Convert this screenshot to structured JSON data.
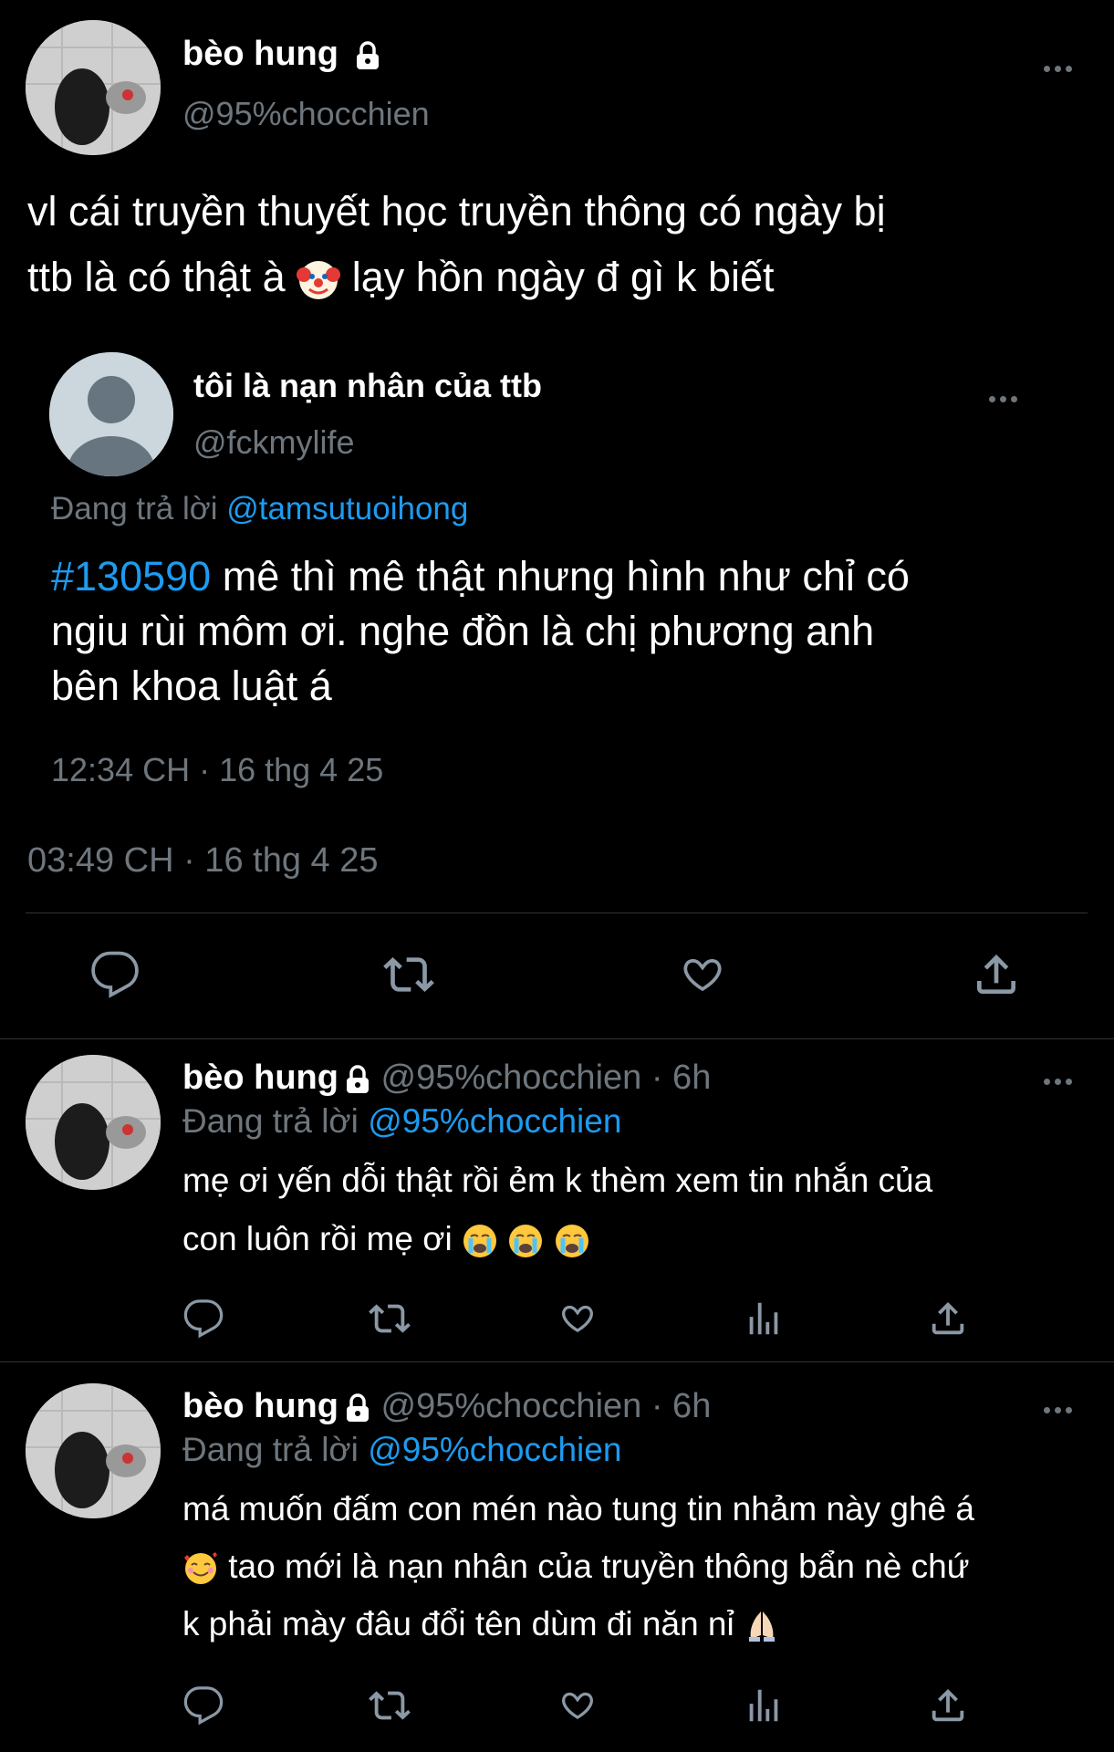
{
  "main_tweet": {
    "author_name": "bèo hung",
    "author_handle": "@95%chocchien",
    "text_line1": "vl cái truyền thuyết học truyền thông có ngày bị",
    "text_line2a": "ttb là có thật à",
    "text_line2b": "lạy hồn ngày đ gì k biết",
    "timestamp": "03:49 CH · 16 thg 4 25"
  },
  "quoted_tweet": {
    "author_name": "tôi là nạn nhân của ttb",
    "author_handle": "@fckmylife",
    "reply_prefix": "Đang trả lời",
    "reply_to": "@tamsutuoihong",
    "hashtag": "#130590",
    "text_line1": "mê thì mê thật nhưng hình như chỉ có",
    "text_line2": "ngiu rùi môm ơi. nghe đồn là chị phương anh",
    "text_line3": "bên khoa luật á",
    "timestamp": "12:34 CH · 16 thg 4 25"
  },
  "replies": [
    {
      "author_name": "bèo hung",
      "author_handle": "@95%chocchien",
      "time": "· 6h",
      "reply_prefix": "Đang trả lời",
      "reply_to": "@95%chocchien",
      "text_line1": "mẹ ơi yến dỗi thật rồi ẻm k thèm xem tin nhắn của",
      "text_line2": "con luôn rồi mẹ ơi"
    },
    {
      "author_name": "bèo hung",
      "author_handle": "@95%chocchien",
      "time": "· 6h",
      "reply_prefix": "Đang trả lời",
      "reply_to": "@95%chocchien",
      "text_line1": "má muốn đấm con mén nào tung tin nhảm này ghê á",
      "text_line2": "tao mới là nạn nhân của truyền thông bẩn nè chứ",
      "text_line3": "k phải mày đâu đổi tên dùm đi năn nỉ"
    }
  ],
  "colors": {
    "background": "#000000",
    "text": "#e7e9ea",
    "muted": "#6e767d",
    "link": "#1d9bf0",
    "divider": "#2f3336"
  },
  "icons": [
    "lock-icon",
    "more-icon",
    "reply-icon",
    "retweet-icon",
    "like-icon",
    "share-icon",
    "views-icon",
    "clown-emoji",
    "crying-emoji",
    "smiling-hearts-emoji",
    "folded-hands-emoji"
  ]
}
